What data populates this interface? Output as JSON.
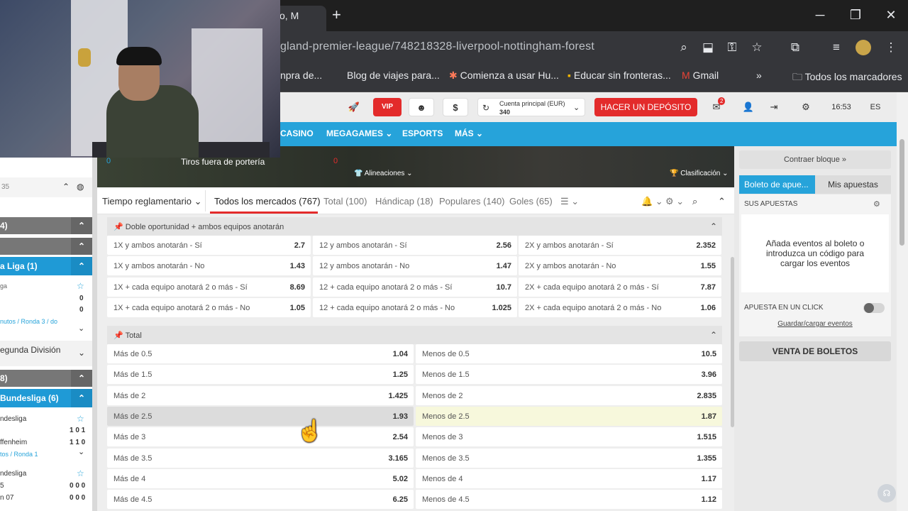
{
  "browser": {
    "tab_title": "o, M",
    "url": "gland-premier-league/748218328-liverpool-nottingham-forest",
    "bookmarks": [
      "npra de...",
      "Blog de viajes para...",
      "Comienza a usar Hu...",
      "Educar sin fronteras...",
      "Gmail",
      "»",
      "Todos los marcadores"
    ]
  },
  "header": {
    "vip": "VIP",
    "account_label": "Cuenta principal (EUR)",
    "account_value": "340",
    "deposit": "HACER UN DEPÓSITO",
    "notif_count": "2",
    "time": "16:53",
    "lang": "ES"
  },
  "nav": [
    "CASINO",
    "MEGAGAMES",
    "ESPORTS",
    "MÁS"
  ],
  "strip": {
    "stat_left": "0",
    "stat_label": "Tiros fuera de portería",
    "stat_right": "0",
    "lineups": "Alineaciones",
    "standings": "Clasificación"
  },
  "market_tabs": {
    "period": "Tiempo reglamentario",
    "tabs": [
      "Todos los mercados (767)",
      "Total (100)",
      "Hándicap (18)",
      "Populares (140)",
      "Goles (65)"
    ]
  },
  "section1": {
    "title": "Doble oportunidad + ambos equipos anotarán",
    "rows": [
      [
        [
          "1X y ambos anotarán - Sí",
          "2.7"
        ],
        [
          "12 y ambos anotarán - Sí",
          "2.56"
        ],
        [
          "2X y ambos anotarán - Sí",
          "2.352"
        ]
      ],
      [
        [
          "1X y ambos anotarán - No",
          "1.43"
        ],
        [
          "12 y ambos anotarán - No",
          "1.47"
        ],
        [
          "2X y ambos anotarán - No",
          "1.55"
        ]
      ],
      [
        [
          "1X + cada equipo anotará 2 o más - Sí",
          "8.69"
        ],
        [
          "12 + cada equipo anotará 2 o más - Sí",
          "10.7"
        ],
        [
          "2X + cada equipo anotará 2 o más - Sí",
          "7.87"
        ]
      ],
      [
        [
          "1X + cada equipo anotará 2 o más - No",
          "1.05"
        ],
        [
          "12 + cada equipo anotará 2 o más - No",
          "1.025"
        ],
        [
          "2X + cada equipo anotará 2 o más - No",
          "1.06"
        ]
      ]
    ]
  },
  "section2": {
    "title": "Total",
    "rows": [
      [
        [
          "Más de 0.5",
          "1.04"
        ],
        [
          "Menos de 0.5",
          "10.5"
        ]
      ],
      [
        [
          "Más de 1.5",
          "1.25"
        ],
        [
          "Menos de 1.5",
          "3.96"
        ]
      ],
      [
        [
          "Más de 2",
          "1.425"
        ],
        [
          "Menos de 2",
          "2.835"
        ]
      ],
      [
        [
          "Más de 2.5",
          "1.93"
        ],
        [
          "Menos de 2.5",
          "1.87"
        ]
      ],
      [
        [
          "Más de 3",
          "2.54"
        ],
        [
          "Menos de 3",
          "1.515"
        ]
      ],
      [
        [
          "Más de 3.5",
          "3.165"
        ],
        [
          "Menos de 3.5",
          "1.355"
        ]
      ],
      [
        [
          "Más de 4",
          "5.02"
        ],
        [
          "Menos de 4",
          "1.17"
        ]
      ],
      [
        [
          "Más de 4.5",
          "6.25"
        ],
        [
          "Menos de 4.5",
          "1.12"
        ]
      ]
    ]
  },
  "left": {
    "id": "35",
    "r1": "4)",
    "r3": "a Liga (1)",
    "r3a": "ga",
    "s1": "0",
    "s2": "0",
    "ronda": "nutos / Ronda 3 / do",
    "segunda": "egunda División",
    "r5": "8)",
    "bundes": "Bundesliga (6)",
    "b1": "ndesliga",
    "b1s": "1 0 1",
    "b2": "ffenheim",
    "b2s": "1 1 0",
    "b3": "tos / Ronda 1",
    "b4": "ndesliga",
    "b5": "5",
    "b5s": "0 0 0",
    "b6": "n 07",
    "b6s": "0 0 0"
  },
  "right": {
    "collapse": "Contraer bloque »",
    "tab_active": "Boleto de apue...",
    "tab_other": "Mis apuestas",
    "your_bets": "SUS APUESTAS",
    "empty_msg": "Añada eventos al boleto o introduzca un código para cargar los eventos",
    "one_click": "APUESTA EN UN CLICK",
    "save_load": "Guardar/cargar eventos",
    "sale": "VENTA DE BOLETOS"
  }
}
